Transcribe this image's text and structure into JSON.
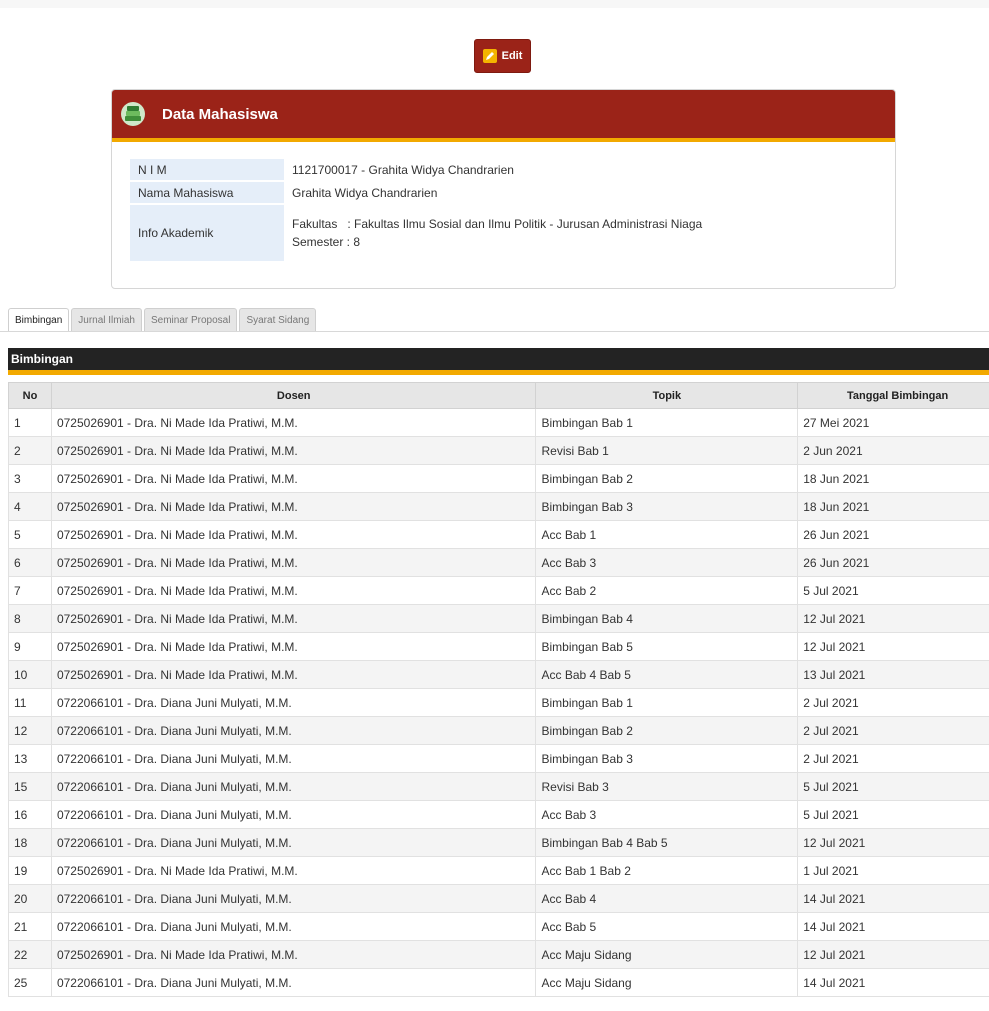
{
  "edit_button": {
    "label": "Edit"
  },
  "panel": {
    "title": "Data Mahasiswa",
    "nim_label": "N I M",
    "nim_value": "1121700017 - Grahita Widya Chandrarien",
    "nama_label": "Nama Mahasiswa",
    "nama_value": "Grahita Widya Chandrarien",
    "info_label": "Info Akademik",
    "fakultas_line": "Fakultas   : Fakultas Ilmu Sosial dan Ilmu Politik - Jurusan Administrasi Niaga",
    "semester_line": "Semester : 8"
  },
  "tabs": [
    "Bimbingan",
    "Jurnal Ilmiah",
    "Seminar Proposal",
    "Syarat Sidang"
  ],
  "active_tab": "Bimbingan",
  "section": {
    "title": "Bimbingan"
  },
  "table": {
    "headers": [
      "No",
      "Dosen",
      "Topik",
      "Tanggal Bimbingan"
    ],
    "rows": [
      [
        "1",
        "0725026901 - Dra. Ni Made Ida Pratiwi, M.M.",
        "Bimbingan Bab 1",
        "27 Mei 2021"
      ],
      [
        "2",
        "0725026901 - Dra. Ni Made Ida Pratiwi, M.M.",
        "Revisi Bab 1",
        "2 Jun 2021"
      ],
      [
        "3",
        "0725026901 - Dra. Ni Made Ida Pratiwi, M.M.",
        "Bimbingan Bab 2",
        "18 Jun 2021"
      ],
      [
        "4",
        "0725026901 - Dra. Ni Made Ida Pratiwi, M.M.",
        "Bimbingan Bab 3",
        "18 Jun 2021"
      ],
      [
        "5",
        "0725026901 - Dra. Ni Made Ida Pratiwi, M.M.",
        "Acc Bab 1",
        "26 Jun 2021"
      ],
      [
        "6",
        "0725026901 - Dra. Ni Made Ida Pratiwi, M.M.",
        "Acc Bab 3",
        "26 Jun 2021"
      ],
      [
        "7",
        "0725026901 - Dra. Ni Made Ida Pratiwi, M.M.",
        "Acc Bab 2",
        "5 Jul 2021"
      ],
      [
        "8",
        "0725026901 - Dra. Ni Made Ida Pratiwi, M.M.",
        "Bimbingan Bab 4",
        "12 Jul 2021"
      ],
      [
        "9",
        "0725026901 - Dra. Ni Made Ida Pratiwi, M.M.",
        "Bimbingan Bab 5",
        "12 Jul 2021"
      ],
      [
        "10",
        "0725026901 - Dra. Ni Made Ida Pratiwi, M.M.",
        "Acc Bab 4 Bab 5",
        "13 Jul 2021"
      ],
      [
        "11",
        "0722066101 - Dra. Diana Juni Mulyati, M.M.",
        "Bimbingan Bab 1",
        "2 Jul 2021"
      ],
      [
        "12",
        "0722066101 - Dra. Diana Juni Mulyati, M.M.",
        "Bimbingan Bab 2",
        "2 Jul 2021"
      ],
      [
        "13",
        "0722066101 - Dra. Diana Juni Mulyati, M.M.",
        "Bimbingan Bab 3",
        "2 Jul 2021"
      ],
      [
        "15",
        "0722066101 - Dra. Diana Juni Mulyati, M.M.",
        "Revisi Bab 3",
        "5 Jul 2021"
      ],
      [
        "16",
        "0722066101 - Dra. Diana Juni Mulyati, M.M.",
        "Acc Bab 3",
        "5 Jul 2021"
      ],
      [
        "18",
        "0722066101 - Dra. Diana Juni Mulyati, M.M.",
        "Bimbingan Bab 4 Bab 5",
        "12 Jul 2021"
      ],
      [
        "19",
        "0725026901 - Dra. Ni Made Ida Pratiwi, M.M.",
        "Acc Bab 1 Bab 2",
        "1 Jul 2021"
      ],
      [
        "20",
        "0722066101 - Dra. Diana Juni Mulyati, M.M.",
        "Acc Bab 4",
        "14 Jul 2021"
      ],
      [
        "21",
        "0722066101 - Dra. Diana Juni Mulyati, M.M.",
        "Acc Bab 5",
        "14 Jul 2021"
      ],
      [
        "22",
        "0725026901 - Dra. Ni Made Ida Pratiwi, M.M.",
        "Acc Maju Sidang",
        "12 Jul 2021"
      ],
      [
        "25",
        "0722066101 - Dra. Diana Juni Mulyati, M.M.",
        "Acc Maju Sidang",
        "14 Jul 2021"
      ]
    ]
  },
  "colors": {
    "brand_red": "#9b2318",
    "accent_orange": "#f2a900",
    "header_dark": "#232323",
    "label_bg": "#e5eef9"
  },
  "icons": {
    "edit": "pencil-icon",
    "panel": "books-icon"
  }
}
